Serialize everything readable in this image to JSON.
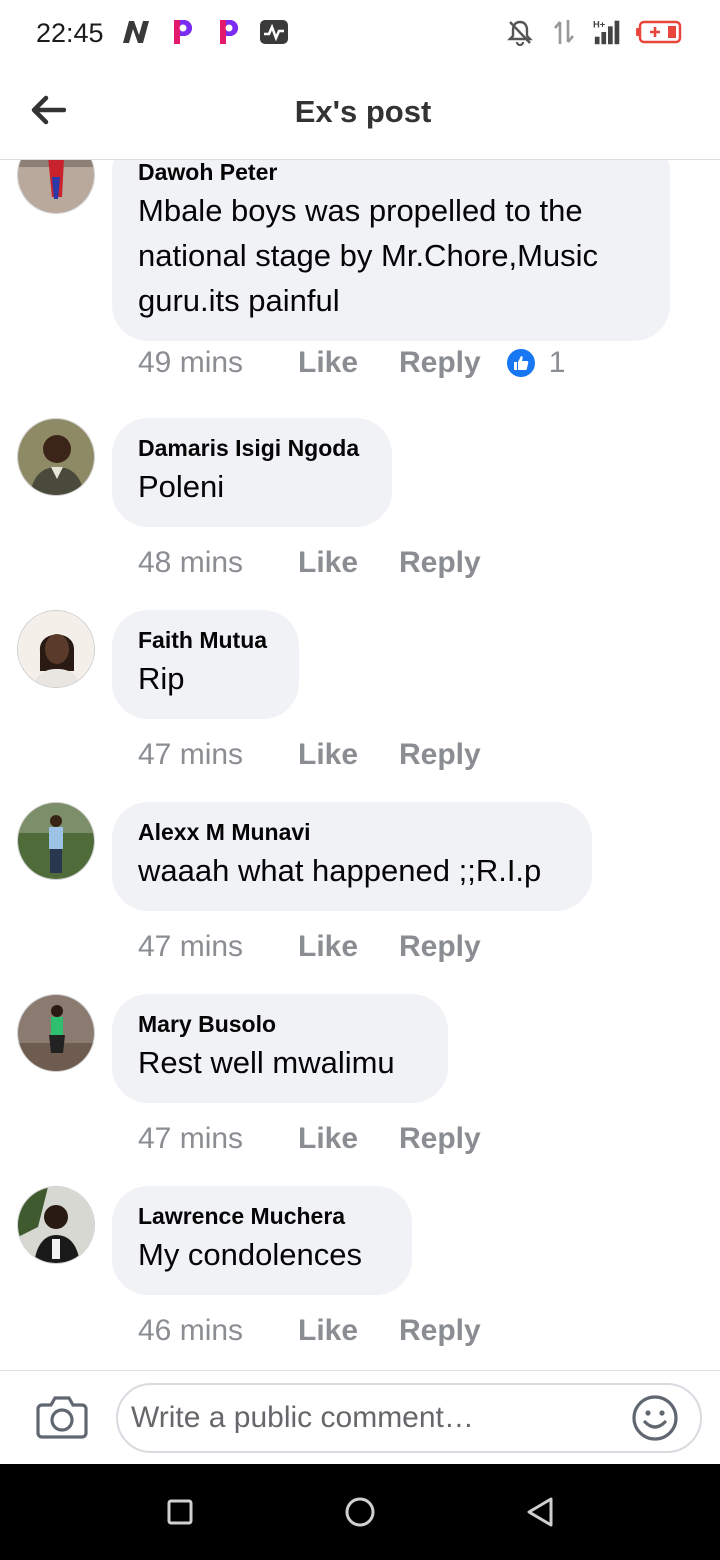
{
  "status_bar": {
    "time": "22:45",
    "left_icons": [
      "n-app-icon",
      "p-app-icon",
      "p-app-icon",
      "activity-icon"
    ],
    "right_icons": [
      "bell-off-icon",
      "data-arrows-icon",
      "signal-hplus-icon",
      "battery-icon"
    ],
    "battery_color": "#e8453c"
  },
  "header": {
    "title": "Ex's post",
    "back_icon": "arrow-left-icon"
  },
  "comments": [
    {
      "author": "Dawoh Peter",
      "text": "Mbale boys was propelled to the national stage by Mr.Chore,Music guru.its painful",
      "time": "49 mins",
      "like_label": "Like",
      "reply_label": "Reply",
      "reaction_count": "1"
    },
    {
      "author": "Damaris Isigi Ngoda",
      "text": "Poleni",
      "time": "48 mins",
      "like_label": "Like",
      "reply_label": "Reply"
    },
    {
      "author": "Faith Mutua",
      "text": "Rip",
      "time": "47 mins",
      "like_label": "Like",
      "reply_label": "Reply"
    },
    {
      "author": "Alexx M Munavi",
      "text": "waaah what happened ;;R.I.p",
      "time": "47 mins",
      "like_label": "Like",
      "reply_label": "Reply"
    },
    {
      "author": "Mary Busolo",
      "text": "Rest well mwalimu",
      "time": "47 mins",
      "like_label": "Like",
      "reply_label": "Reply"
    },
    {
      "author": "Lawrence Muchera",
      "text": "My condolences",
      "time": "46 mins",
      "like_label": "Like",
      "reply_label": "Reply"
    }
  ],
  "composer": {
    "placeholder": "Write a public comment…",
    "camera_icon": "camera-icon",
    "emoji_icon": "emoji-icon"
  },
  "colors": {
    "bubble": "#f0f2f5",
    "meta_text": "#8a8d91",
    "like_reaction": "#1877f2"
  }
}
